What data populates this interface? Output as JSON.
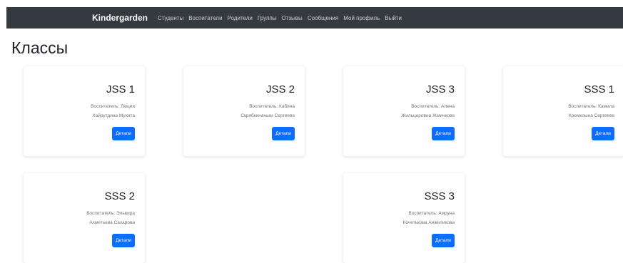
{
  "navbar": {
    "brand": "Kindergarden",
    "links": [
      "Студенты",
      "Воспитатели",
      "Родители",
      "Группы",
      "Отзывы",
      "Сообщения",
      "Мой профиль",
      "Выйти"
    ]
  },
  "page": {
    "title": "Классы"
  },
  "classes": [
    {
      "name": "JSS 1",
      "teacher_line1": "Воспитатель: Люция",
      "teacher_line2": "Хайрутдина Мухита",
      "button": "Детали"
    },
    {
      "name": "JSS 2",
      "teacher_line1": "Воспитатель: Кабина",
      "teacher_line2": "Скрябкинаньки Сергеева",
      "button": "Детали"
    },
    {
      "name": "JSS 3",
      "teacher_line1": "Воспитатель: Алена",
      "teacher_line2": "Жильцеровна Жмичкова",
      "button": "Детали"
    },
    {
      "name": "SSS 1",
      "teacher_line1": "Воспитатель: Камила",
      "teacher_line2": "Кремкоына Сергеева",
      "button": "Детали"
    },
    {
      "name": "SSS 2",
      "teacher_line1": "Воспитатель: Эльвира",
      "teacher_line2": "Ахметьева Сахарова",
      "button": "Детали"
    },
    {
      "name": "SSS 3",
      "teacher_line1": "Воспитатель: Амруна",
      "teacher_line2": "Кочетькова Анжеликова",
      "button": "Детали"
    }
  ],
  "colors": {
    "navbar_bg": "#343a40",
    "button_bg": "#0d6efd"
  }
}
